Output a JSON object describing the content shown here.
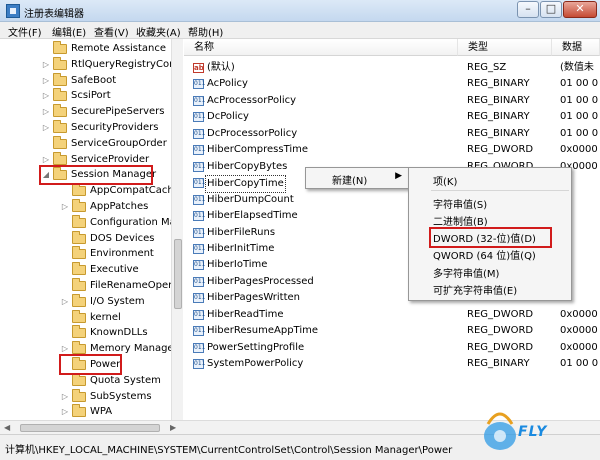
{
  "window": {
    "title": "注册表编辑器"
  },
  "menubar": [
    "文件(F)",
    "编辑(E)",
    "查看(V)",
    "收藏夹(A)",
    "帮助(H)"
  ],
  "tree": [
    {
      "label": "Remote Assistance",
      "expander": ""
    },
    {
      "label": "RtlQueryRegistryConfig",
      "expander": "▷"
    },
    {
      "label": "SafeBoot",
      "expander": "▷"
    },
    {
      "label": "ScsiPort",
      "expander": "▷"
    },
    {
      "label": "SecurePipeServers",
      "expander": "▷"
    },
    {
      "label": "SecurityProviders",
      "expander": "▷"
    },
    {
      "label": "ServiceGroupOrder",
      "expander": ""
    },
    {
      "label": "ServiceProvider",
      "expander": "▷"
    },
    {
      "label": "Session Manager",
      "expander": "◢"
    },
    {
      "label": "AppCompatCache",
      "expander": ""
    },
    {
      "label": "AppPatches",
      "expander": "▷"
    },
    {
      "label": "Configuration Manager",
      "expander": ""
    },
    {
      "label": "DOS Devices",
      "expander": ""
    },
    {
      "label": "Environment",
      "expander": ""
    },
    {
      "label": "Executive",
      "expander": ""
    },
    {
      "label": "FileRenameOperations",
      "expander": ""
    },
    {
      "label": "I/O System",
      "expander": "▷"
    },
    {
      "label": "kernel",
      "expander": ""
    },
    {
      "label": "KnownDLLs",
      "expander": ""
    },
    {
      "label": "Memory Management",
      "expander": "▷"
    },
    {
      "label": "Power",
      "expander": ""
    },
    {
      "label": "Quota System",
      "expander": ""
    },
    {
      "label": "SubSystems",
      "expander": "▷"
    },
    {
      "label": "WPA",
      "expander": "▷"
    }
  ],
  "columns": {
    "name": "名称",
    "type": "类型",
    "data": "数据"
  },
  "values": [
    {
      "name": "(默认)",
      "type": "REG_SZ",
      "data": "(数值未",
      "icon": "ab"
    },
    {
      "name": "AcPolicy",
      "type": "REG_BINARY",
      "data": "01 00 0",
      "icon": "bin"
    },
    {
      "name": "AcProcessorPolicy",
      "type": "REG_BINARY",
      "data": "01 00 0",
      "icon": "bin"
    },
    {
      "name": "DcPolicy",
      "type": "REG_BINARY",
      "data": "01 00 0",
      "icon": "bin"
    },
    {
      "name": "DcProcessorPolicy",
      "type": "REG_BINARY",
      "data": "01 00 0",
      "icon": "bin"
    },
    {
      "name": "HiberCompressTime",
      "type": "REG_DWORD",
      "data": "0x0000",
      "icon": "bin"
    },
    {
      "name": "HiberCopyBytes",
      "type": "REG_QWORD",
      "data": "0x0000",
      "icon": "bin"
    },
    {
      "name": "HiberCopyTime",
      "type": "",
      "data": "",
      "icon": "bin"
    },
    {
      "name": "HiberDumpCount",
      "type": "",
      "data": "",
      "icon": "bin"
    },
    {
      "name": "HiberElapsedTime",
      "type": "",
      "data": "",
      "icon": "bin"
    },
    {
      "name": "HiberFileRuns",
      "type": "",
      "data": "",
      "icon": "bin"
    },
    {
      "name": "HiberInitTime",
      "type": "",
      "data": "",
      "icon": "bin"
    },
    {
      "name": "HiberIoTime",
      "type": "",
      "data": "",
      "icon": "bin"
    },
    {
      "name": "HiberPagesProcessed",
      "type": "",
      "data": "",
      "icon": "bin"
    },
    {
      "name": "HiberPagesWritten",
      "type": "",
      "data": "",
      "icon": "bin"
    },
    {
      "name": "HiberReadTime",
      "type": "REG_DWORD",
      "data": "0x0000",
      "icon": "bin"
    },
    {
      "name": "HiberResumeAppTime",
      "type": "REG_DWORD",
      "data": "0x0000",
      "icon": "bin"
    },
    {
      "name": "PowerSettingProfile",
      "type": "REG_DWORD",
      "data": "0x0000",
      "icon": "bin"
    },
    {
      "name": "SystemPowerPolicy",
      "type": "REG_BINARY",
      "data": "01 00 0",
      "icon": "bin"
    }
  ],
  "context_menu": {
    "new_label": "新建(N)",
    "arrow": "▶"
  },
  "submenu": [
    "项(K)",
    "字符串值(S)",
    "二进制值(B)",
    "DWORD (32-位)值(D)",
    "QWORD (64 位)值(Q)",
    "多字符串值(M)",
    "可扩充字符串值(E)"
  ],
  "statusbar": {
    "path": "计算机\\HKEY_LOCAL_MACHINE\\SYSTEM\\CurrentControlSet\\Control\\Session Manager\\Power"
  },
  "watermark": {
    "text": "FLY"
  },
  "colors": {
    "highlight": "#d11b1b",
    "folder": "#f4d27a"
  }
}
